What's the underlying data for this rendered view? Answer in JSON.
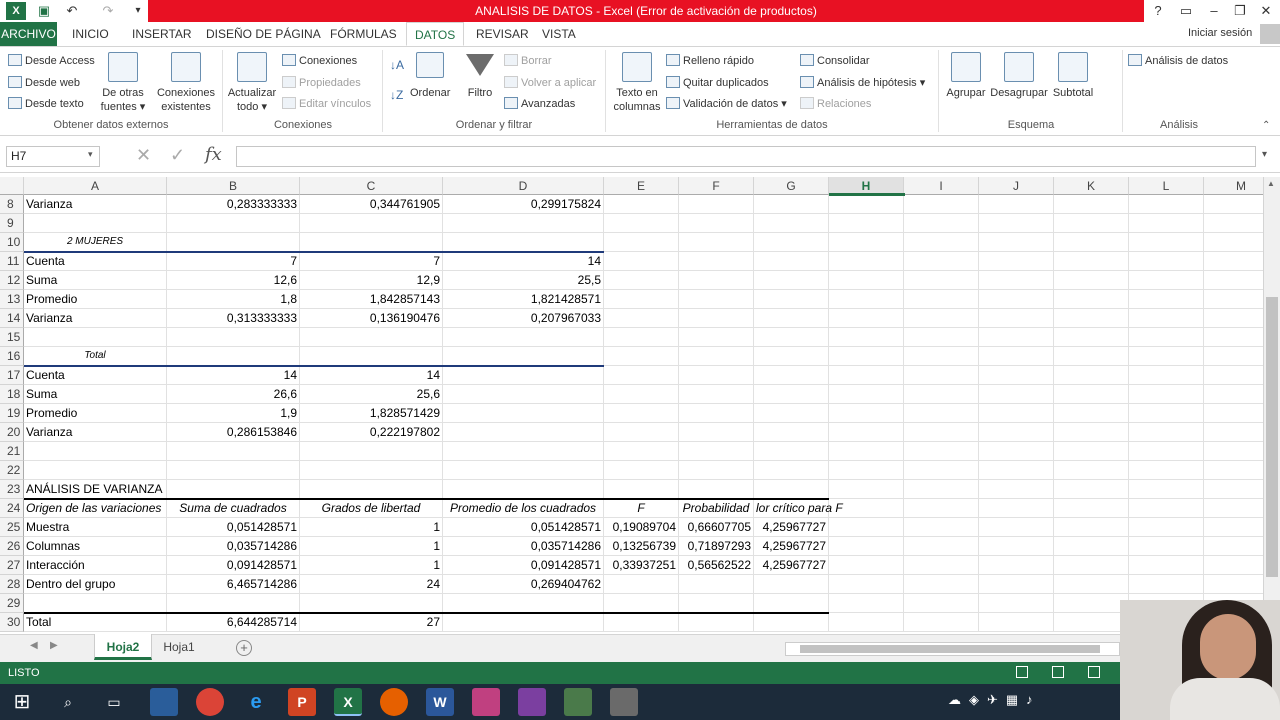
{
  "window": {
    "title": "ANALISIS DE DATOS -  Excel (Error de activación de productos)",
    "help_icon": "?",
    "minimize_icon": "–",
    "restore_icon": "❐",
    "close_icon": "✕",
    "login": "Iniciar sesión"
  },
  "tabs": [
    "ARCHIVO",
    "INICIO",
    "INSERTAR",
    "DISEÑO DE PÁGINA",
    "FÓRMULAS",
    "DATOS",
    "REVISAR",
    "VISTA"
  ],
  "ribbon": {
    "ext": {
      "access": "Desde Access",
      "web": "Desde web",
      "texto": "Desde texto",
      "otras1": "De otras",
      "otras2": "fuentes",
      "conex1": "Conexiones",
      "conex2": "existentes",
      "group": "Obtener datos externos"
    },
    "conn": {
      "act1": "Actualizar",
      "act2": "todo",
      "conexiones": "Conexiones",
      "propiedades": "Propiedades",
      "editar": "Editar vínculos",
      "group": "Conexiones"
    },
    "sort": {
      "ordenar": "Ordenar",
      "filtro": "Filtro",
      "borrar": "Borrar",
      "volver": "Volver a aplicar",
      "avanzadas": "Avanzadas",
      "group": "Ordenar y filtrar"
    },
    "tools": {
      "texto1": "Texto en",
      "texto2": "columnas",
      "relleno": "Relleno rápido",
      "quitar": "Quitar duplicados",
      "validacion": "Validación de datos",
      "consolidar": "Consolidar",
      "hipotesis": "Análisis de hipótesis",
      "relaciones": "Relaciones",
      "group": "Herramientas de datos"
    },
    "outline": {
      "agrupar": "Agrupar",
      "desagrupar": "Desagrupar",
      "subtotal": "Subtotal",
      "group": "Esquema"
    },
    "analysis": {
      "analisis": "Análisis de datos",
      "group": "Análisis"
    }
  },
  "formula": {
    "namebox": "H7",
    "fx": "fx",
    "value": ""
  },
  "columns": [
    "A",
    "B",
    "C",
    "D",
    "E",
    "F",
    "G",
    "H",
    "I",
    "J",
    "K",
    "L",
    "M"
  ],
  "rows": [
    {
      "n": "8",
      "A": "Varianza",
      "B": "0,283333333",
      "C": "0,344761905",
      "D": "0,299175824"
    },
    {
      "n": "9"
    },
    {
      "n": "10",
      "A_it": "2 MUJERES"
    },
    {
      "n": "11",
      "A": "Cuenta",
      "B": "7",
      "C": "7",
      "D": "14"
    },
    {
      "n": "12",
      "A": "Suma",
      "B": "12,6",
      "C": "12,9",
      "D": "25,5"
    },
    {
      "n": "13",
      "A": "Promedio",
      "B": "1,8",
      "C": "1,842857143",
      "D": "1,821428571"
    },
    {
      "n": "14",
      "A": "Varianza",
      "B": "0,313333333",
      "C": "0,136190476",
      "D": "0,207967033"
    },
    {
      "n": "15"
    },
    {
      "n": "16",
      "A_it": "Total"
    },
    {
      "n": "17",
      "A": "Cuenta",
      "B": "14",
      "C": "14"
    },
    {
      "n": "18",
      "A": "Suma",
      "B": "26,6",
      "C": "25,6"
    },
    {
      "n": "19",
      "A": "Promedio",
      "B": "1,9",
      "C": "1,828571429"
    },
    {
      "n": "20",
      "A": "Varianza",
      "B": "0,286153846",
      "C": "0,222197802"
    },
    {
      "n": "21"
    },
    {
      "n": "22"
    },
    {
      "n": "23",
      "A": "ANÁLISIS DE VARIANZA"
    },
    {
      "n": "24",
      "hdr": [
        "Origen de las variaciones",
        "Suma de cuadrados",
        "Grados de libertad",
        "Promedio de los cuadrados",
        "F",
        "Probabilidad",
        "lor crítico para F"
      ]
    },
    {
      "n": "25",
      "A": "Muestra",
      "B": "0,051428571",
      "C": "1",
      "D": "0,051428571",
      "E": "0,19089704",
      "F": "0,66607705",
      "G": "4,25967727"
    },
    {
      "n": "26",
      "A": "Columnas",
      "B": "0,035714286",
      "C": "1",
      "D": "0,035714286",
      "E": "0,13256739",
      "F": "0,71897293",
      "G": "4,25967727"
    },
    {
      "n": "27",
      "A": "Interacción",
      "B": "0,091428571",
      "C": "1",
      "D": "0,091428571",
      "E": "0,33937251",
      "F": "0,56562522",
      "G": "4,25967727"
    },
    {
      "n": "28",
      "A": "Dentro del grupo",
      "B": "6,465714286",
      "C": "24",
      "D": "0,269404762"
    },
    {
      "n": "29"
    },
    {
      "n": "30",
      "A": "Total",
      "B": "6,644285714",
      "C": "27"
    }
  ],
  "sheets": {
    "active": "Hoja2",
    "other": "Hoja1",
    "add": "+"
  },
  "status": {
    "text": "LISTO"
  }
}
